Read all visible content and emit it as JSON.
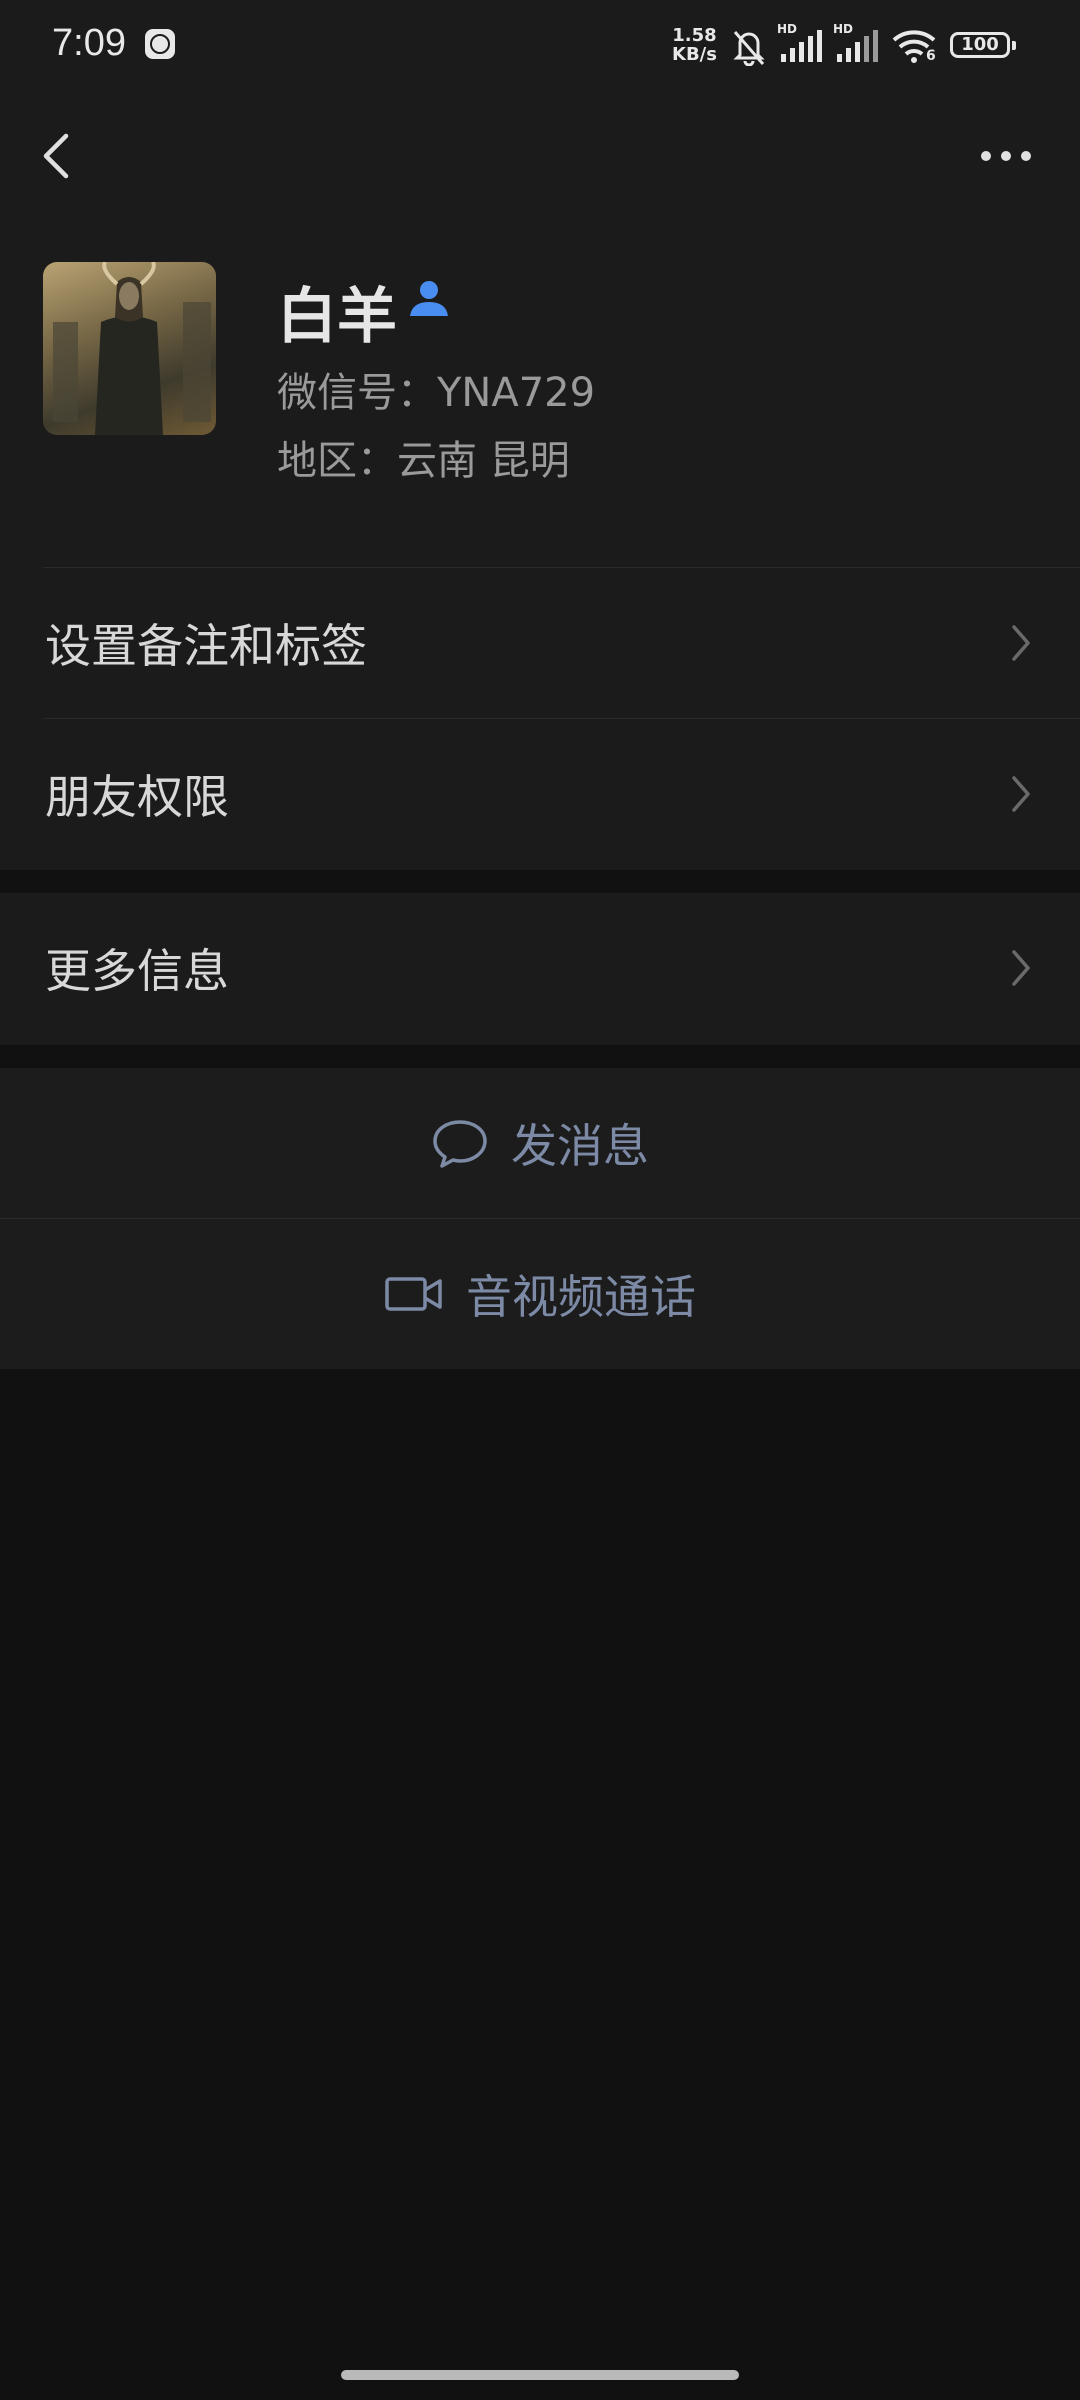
{
  "status_bar": {
    "time": "7:09",
    "net_speed_value": "1.58",
    "net_speed_unit": "KB/s",
    "battery": "100",
    "signal_1_label": "HD",
    "signal_2_label": "HD",
    "wifi_label": "6",
    "icons": [
      "alarm-clock-icon",
      "mute-bell-icon",
      "signal-icon",
      "signal-icon",
      "wifi-icon",
      "battery-icon"
    ]
  },
  "nav": {
    "back_icon": "chevron-left-icon",
    "more_icon": "more-dots-icon"
  },
  "profile": {
    "name": "白羊",
    "wechat_id": "微信号：YNA729",
    "region": "地区：云南  昆明",
    "verify_icon": "person-icon",
    "verify_icon_color": "#4a8df0"
  },
  "menu": [
    {
      "label": "设置备注和标签"
    },
    {
      "label": "朋友权限"
    },
    {
      "label": "更多信息"
    }
  ],
  "actions": {
    "send_message": "发消息",
    "video_call": "音视频通话",
    "accent_color": "#7c8aa6"
  }
}
